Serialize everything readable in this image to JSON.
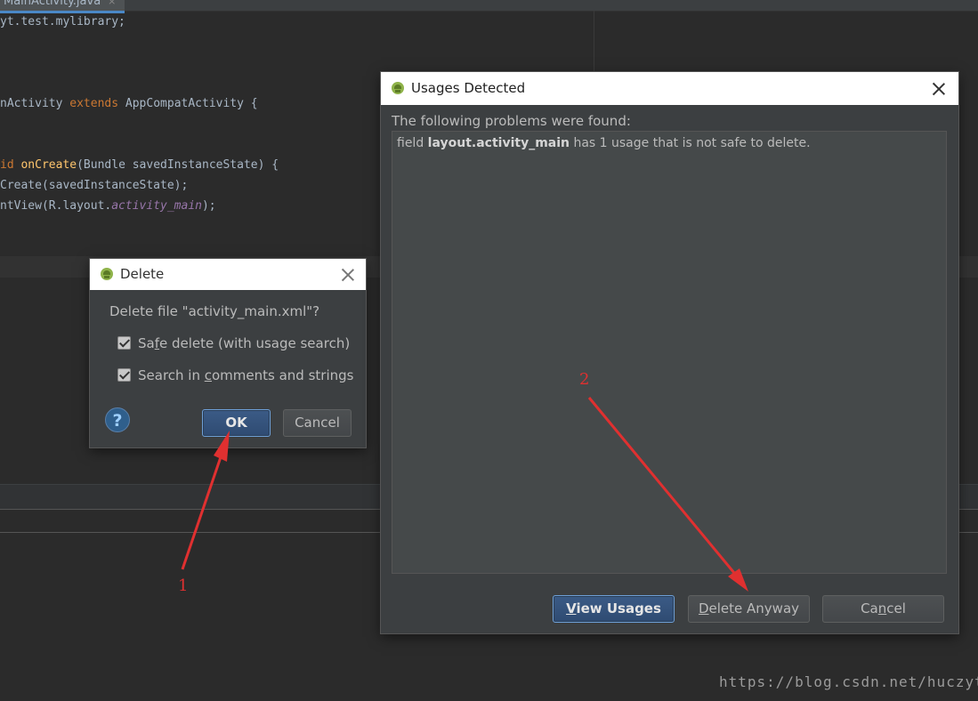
{
  "editor": {
    "tab_label": "MainActivity.java",
    "tab_close": "×",
    "lines": {
      "l1": "yt.test.mylibrary;",
      "l2_a": "nActivity ",
      "l2_kw": "extends",
      "l2_b": " AppCompatActivity {",
      "l3_kw": "id ",
      "l3_fn": "onCreate",
      "l3_b": "(Bundle savedInstanceState) {",
      "l4": "Create(savedInstanceState);",
      "l5_a": "ntView(R.layout.",
      "l5_it": "activity_main",
      "l5_b": ");"
    }
  },
  "delete_dialog": {
    "title": "Delete",
    "question": "Delete file \"activity_main.xml\"?",
    "safe_delete": {
      "pre": "Sa",
      "mnemonic": "f",
      "post": "e delete (with usage search)",
      "checked": true
    },
    "search_comments": {
      "pre": "Search in ",
      "mnemonic": "c",
      "post": "omments and strings",
      "checked": true
    },
    "help_glyph": "?",
    "ok_label": "OK",
    "cancel_label": "Cancel"
  },
  "usages_dialog": {
    "title": "Usages Detected",
    "header": "The following problems were found:",
    "problem": {
      "pre": "field ",
      "name": "layout.activity_main",
      "post": " has 1 usage that is not safe to delete."
    },
    "view_usages": {
      "mnemonic": "V",
      "rest": "iew Usages"
    },
    "delete_anyway": {
      "mnemonic": "D",
      "rest": "elete Anyway"
    },
    "cancel": {
      "pre": "Ca",
      "mnemonic": "n",
      "post": "cel"
    }
  },
  "annotations": {
    "label_1": "1",
    "label_2": "2",
    "color": "#e03030"
  },
  "watermark": "https://blog.csdn.net/huczyt"
}
